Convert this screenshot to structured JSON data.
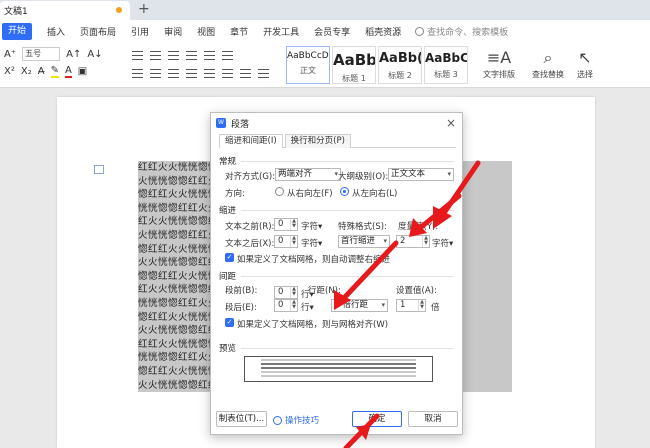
{
  "window": {
    "doc_tab": "文稿1",
    "new_tab": "+"
  },
  "menu": {
    "items": [
      "开始",
      "插入",
      "页面布局",
      "引用",
      "审阅",
      "视图",
      "章节",
      "开发工具",
      "会员专享",
      "稻壳资源"
    ],
    "search": "查找命令、搜索模板"
  },
  "ribbon": {
    "font_size": "五号",
    "styles": [
      {
        "sample": "AaBbCcDd",
        "caption": "正文"
      },
      {
        "sample": "AaBb",
        "caption": "标题 1"
      },
      {
        "sample": "AaBb(",
        "caption": "标题 2"
      },
      {
        "sample": "AaBbC",
        "caption": "标题 3"
      }
    ],
    "text_layout": "文字排版",
    "find_replace": "查找替换",
    "select": "选择"
  },
  "document": {
    "lines": [
      "红红火火恍恍惚惚红红火火恍恍惚惚红红火火恍恍惚惚红红火火",
      "火恍恍惚惚红红火火恍恍惚惚红红火火恍恍惚惚红红火火恍恍惚惚",
      "惚红红火火恍恍惚惚红红火火恍恍惚惚红红火火恍恍惚惚红红火火",
      "恍恍惚惚红红火火恍恍惚惚红红火火恍恍惚惚红红火火恍恍惚惚红",
      "红火火恍恍惚惚红红火火恍恍惚惚红红火火恍恍惚惚红红火火恍恍",
      "火恍恍惚惚红红火火恍恍惚惚红红火火恍恍惚惚红红火火恍恍惚惚",
      "惚红红火火恍恍惚惚红红火火恍恍惚惚红红火火恍恍惚惚红红火火",
      "火火恍恍惚惚红红火火恍恍惚惚红红火火恍恍惚惚红红火火恍恍惚",
      "惚惚红红火火恍恍惚惚红红火火恍恍惚惚红红火火恍恍惚惚红红火",
      "红火火恍恍惚惚红红火火恍恍惚惚红红火火恍恍惚惚红红火火恍恍",
      "恍恍惚惚红红火火恍恍惚惚红红火火恍恍惚惚红红火火恍恍惚惚红",
      "惚红红火火恍恍惚惚红红火火恍恍惚惚红红火火恍恍惚惚红红火火",
      "火火恍恍惚惚红红火火恍恍惚惚红红火火恍恍惚惚红红火火恍恍惚",
      "红红火火恍恍惚惚红红火火恍恍惚惚红红火火恍恍惚惚红红火火恍",
      "恍恍惚惚红红火火恍恍惚惚红红火火恍恍惚惚红红火火恍恍惚惚红",
      "惚红红火火恍恍惚惚红红火火恍恍惚惚红红火火恍恍惚惚红红火火",
      "火火恍恍惚惚红红火火恍恍惚惚红红火火恍恍惚惚红红火火恍恍惚"
    ]
  },
  "dialog": {
    "title": "段落",
    "tabs": [
      "缩进和间距(I)",
      "换行和分页(P)"
    ],
    "general": {
      "heading": "常规",
      "align_label": "对齐方式(G):",
      "align_value": "两端对齐",
      "outline_label": "大纲级别(O):",
      "outline_value": "正文文本",
      "direction_label": "方向:",
      "rtl": "从右向左(F)",
      "ltr": "从左向右(L)"
    },
    "indent": {
      "heading": "缩进",
      "before_label": "文本之前(R):",
      "before_value": "0",
      "before_unit": "字符▾",
      "after_label": "文本之后(X):",
      "after_value": "0",
      "after_unit": "字符▾",
      "special_label": "特殊格式(S):",
      "special_value": "首行缩进",
      "measure_label": "度量值(Y):",
      "measure_value": "2",
      "measure_unit": "字符▾",
      "grid_check": "如果定义了文档网格，则自动调整右缩进"
    },
    "spacing": {
      "heading": "间距",
      "before_label": "段前(B):",
      "before_value": "0",
      "before_unit": "行▾",
      "after_label": "段后(E):",
      "after_value": "0",
      "after_unit": "行▾",
      "line_label": "行距(N):",
      "line_value": "多倍行距",
      "setting_label": "设置值(A):",
      "setting_value": "1",
      "setting_unit": "倍",
      "grid_check": "如果定义了文档网格，则与网格对齐(W)"
    },
    "preview_heading": "预览",
    "tabs_button": "制表位(T)...",
    "tips": "操作技巧",
    "ok": "确定",
    "cancel": "取消"
  },
  "colors": {
    "accent": "#2f6df6",
    "arrow": "#e8191b",
    "selection": "#c8c8c8"
  }
}
